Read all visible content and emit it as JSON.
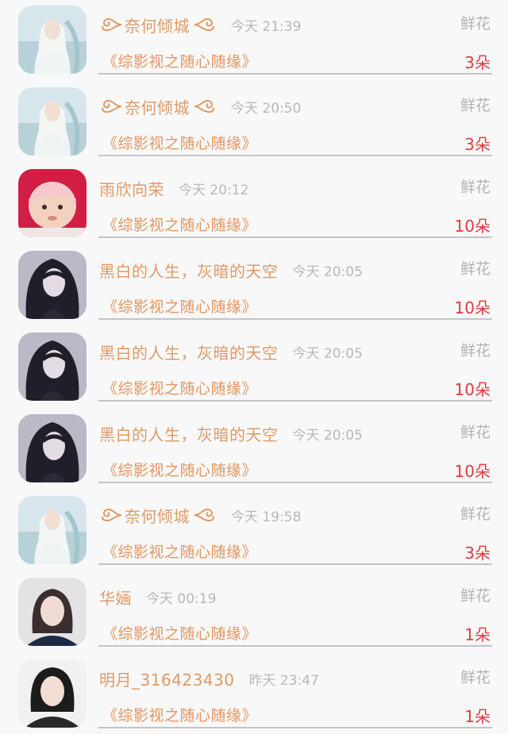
{
  "records": [
    {
      "user": "奈何倾城",
      "decorated": true,
      "time": "今天 21:39",
      "gift_type": "鲜花",
      "book": "《综影视之随心随缘》",
      "count": "3朵",
      "avatar": "avatar-white-haired-character"
    },
    {
      "user": "奈何倾城",
      "decorated": true,
      "time": "今天 20:50",
      "gift_type": "鲜花",
      "book": "《综影视之随心随缘》",
      "count": "3朵",
      "avatar": "avatar-white-haired-character"
    },
    {
      "user": "雨欣向荣",
      "decorated": false,
      "time": "今天 20:12",
      "gift_type": "鲜花",
      "book": "《综影视之随心随缘》",
      "count": "10朵",
      "avatar": "avatar-baby"
    },
    {
      "user": "黑白的人生，灰暗的天空",
      "decorated": false,
      "time": "今天 20:05",
      "gift_type": "鲜花",
      "book": "《综影视之随心随缘》",
      "count": "10朵",
      "avatar": "avatar-dark-haired-character"
    },
    {
      "user": "黑白的人生，灰暗的天空",
      "decorated": false,
      "time": "今天 20:05",
      "gift_type": "鲜花",
      "book": "《综影视之随心随缘》",
      "count": "10朵",
      "avatar": "avatar-dark-haired-character"
    },
    {
      "user": "黑白的人生，灰暗的天空",
      "decorated": false,
      "time": "今天 20:05",
      "gift_type": "鲜花",
      "book": "《综影视之随心随缘》",
      "count": "10朵",
      "avatar": "avatar-dark-haired-character"
    },
    {
      "user": "奈何倾城",
      "decorated": true,
      "time": "今天 19:58",
      "gift_type": "鲜花",
      "book": "《综影视之随心随缘》",
      "count": "3朵",
      "avatar": "avatar-white-haired-character"
    },
    {
      "user": "华婳",
      "decorated": false,
      "time": "今天 00:19",
      "gift_type": "鲜花",
      "book": "《综影视之随心随缘》",
      "count": "1朵",
      "avatar": "avatar-girl-photo"
    },
    {
      "user": "明月_316423430",
      "decorated": false,
      "time": "昨天 23:47",
      "gift_type": "鲜花",
      "book": "《综影视之随心随缘》",
      "count": "1朵",
      "avatar": "avatar-woman-photo"
    }
  ],
  "colors": {
    "name": "#e09a66",
    "book": "#e6955e",
    "count": "#e43a3c",
    "meta": "#b8b8b8"
  }
}
